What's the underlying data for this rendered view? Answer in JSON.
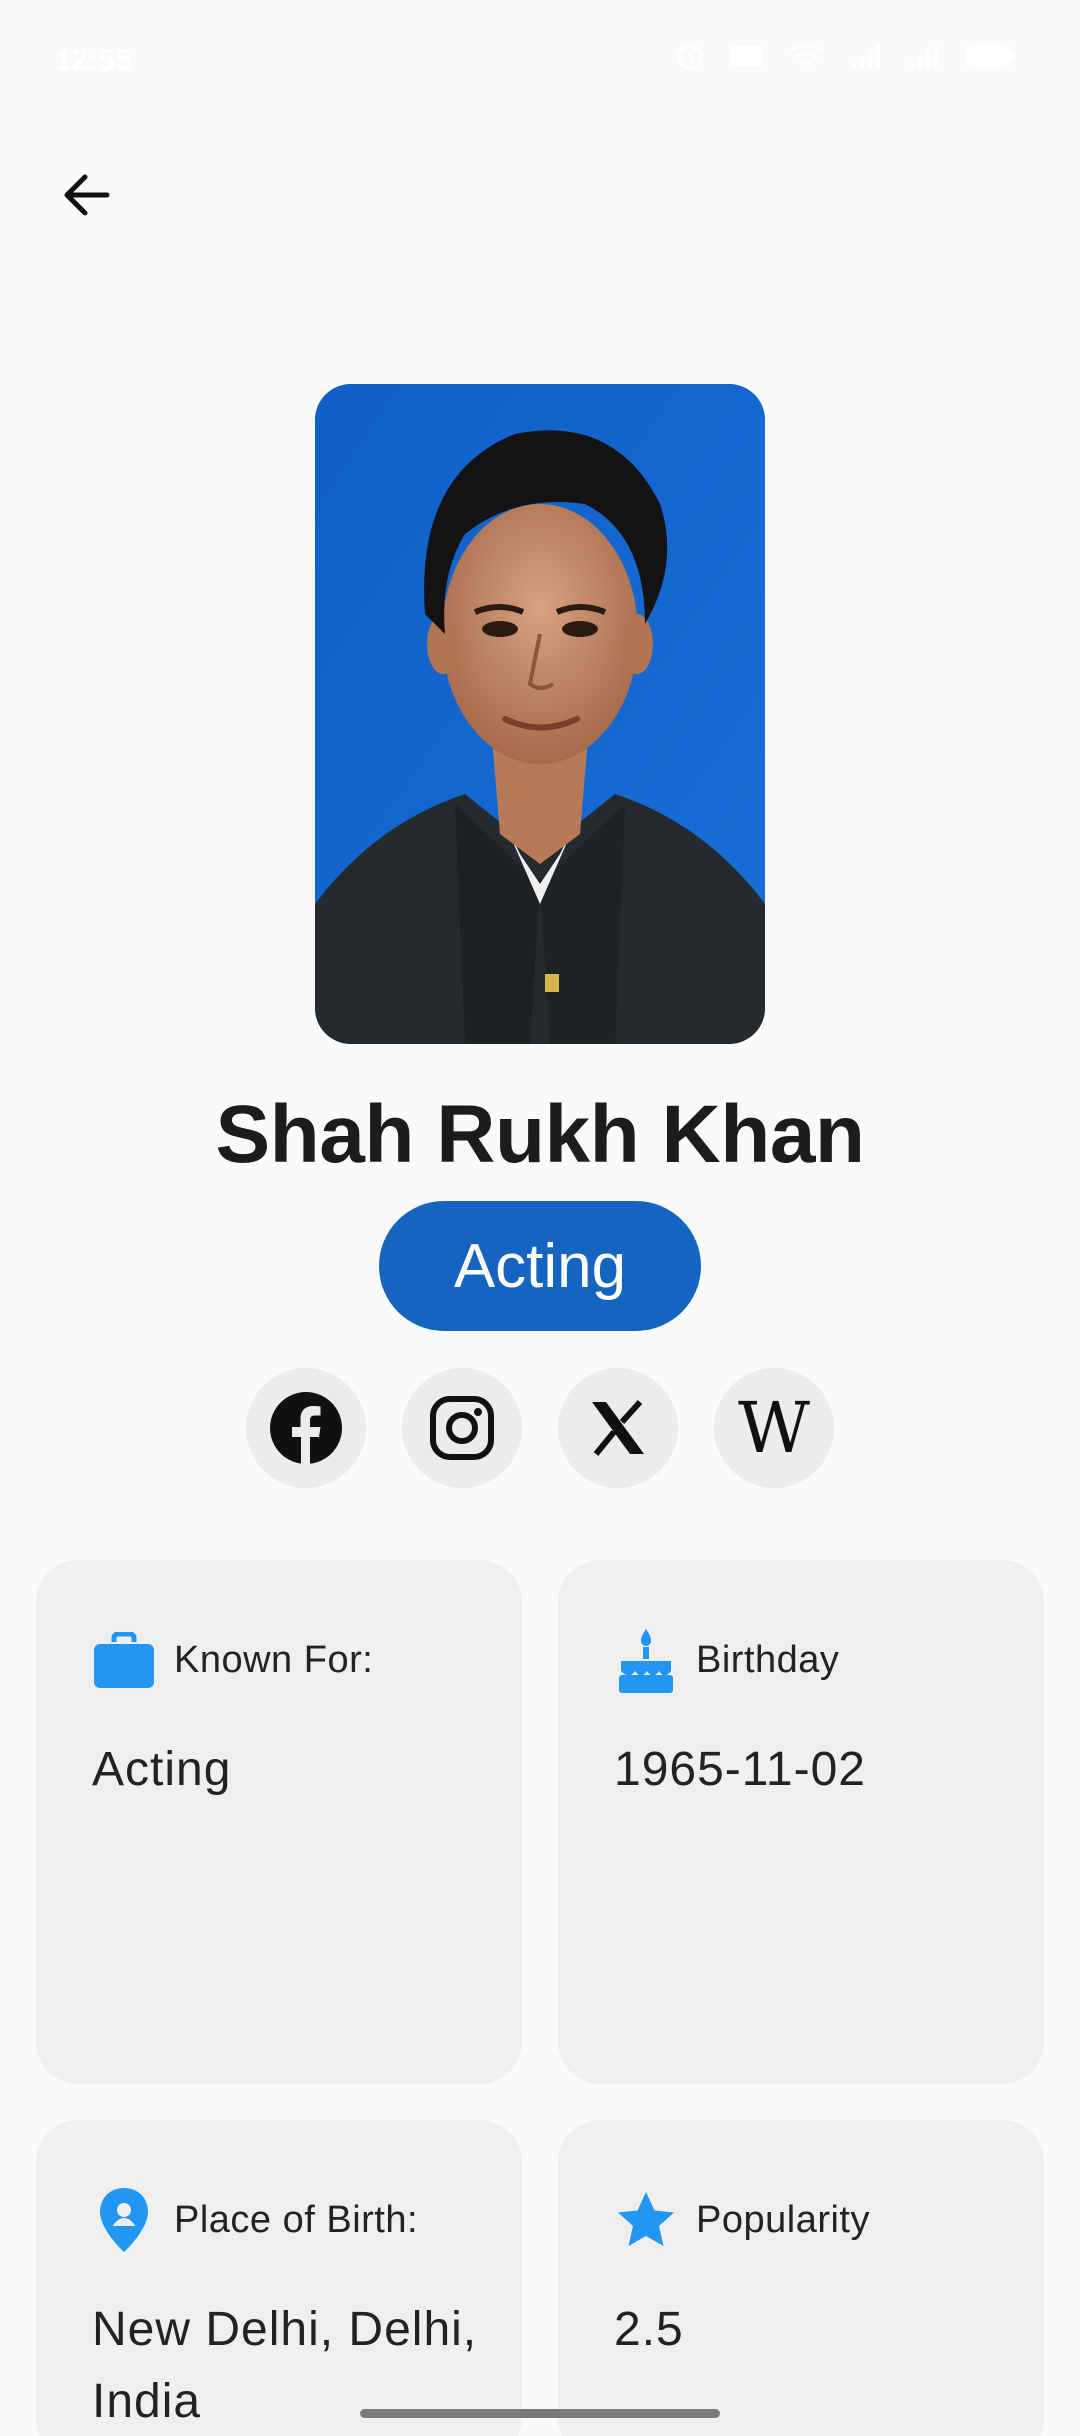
{
  "status_bar": {
    "time": "12:55"
  },
  "header": {
    "back_icon": "arrow-left-icon"
  },
  "profile": {
    "name": "Shah Rukh Khan",
    "department": "Acting",
    "photo_icon": "person-portrait"
  },
  "social": [
    {
      "name": "facebook",
      "icon": "facebook-icon"
    },
    {
      "name": "instagram",
      "icon": "instagram-icon"
    },
    {
      "name": "x",
      "icon": "x-icon"
    },
    {
      "name": "wikipedia",
      "icon": "wikipedia-icon",
      "glyph": "W"
    }
  ],
  "cards": {
    "known_for": {
      "label": "Known For:",
      "value": "Acting",
      "icon": "briefcase-icon"
    },
    "birthday": {
      "label": "Birthday",
      "value": "1965-11-02",
      "icon": "cake-icon"
    },
    "place_of_birth": {
      "label": "Place of Birth:",
      "value": "New Delhi, Delhi, India",
      "icon": "location-pin-icon"
    },
    "popularity": {
      "label": "Popularity",
      "value": "2.5",
      "icon": "star-icon"
    }
  },
  "colors": {
    "accent": "#1565c0",
    "icon_blue": "#2196f3",
    "card_bg": "#efefef",
    "background": "#fafafa"
  }
}
